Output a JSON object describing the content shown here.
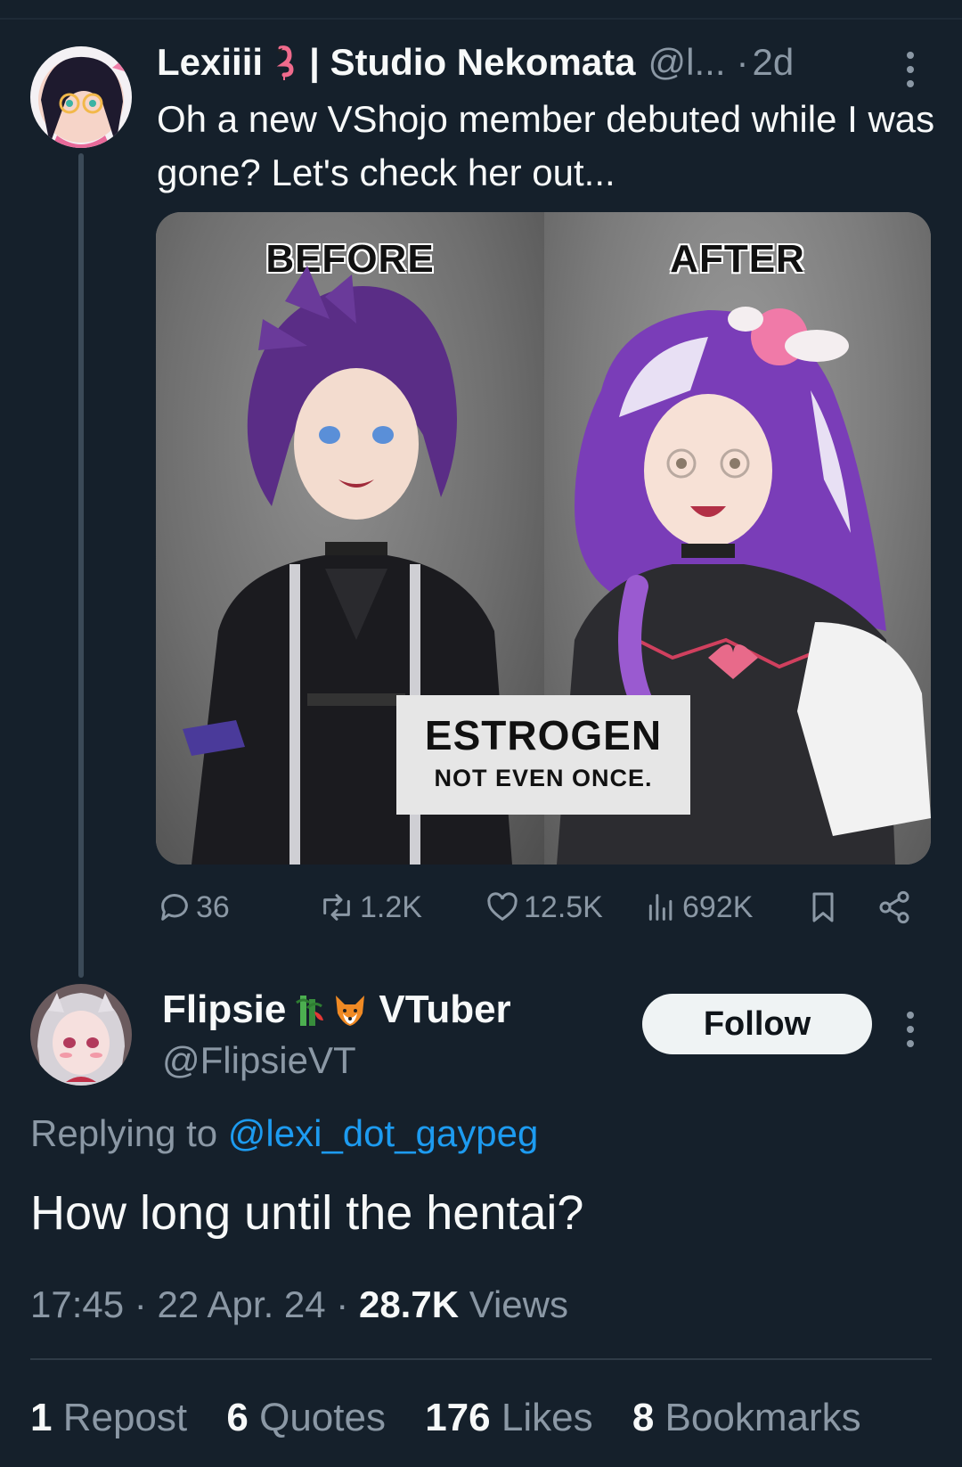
{
  "tweet": {
    "author_name": "Lexiiii",
    "author_suffix": "| Studio Nekomata",
    "author_handle_truncated": "@l...",
    "separator": "·",
    "time_ago": "2d",
    "text": "Oh a new VShojo member debuted while I was gone? Let's check her out...",
    "media": {
      "left_label": "BEFORE",
      "right_label": "AFTER",
      "caption_main": "ESTROGEN",
      "caption_sub": "NOT EVEN ONCE."
    },
    "actions": {
      "replies": "36",
      "reposts": "1.2K",
      "likes": "12.5K",
      "views": "692K"
    }
  },
  "reply": {
    "author_name": "Flipsie",
    "author_suffix": "VTuber",
    "author_handle": "@FlipsieVT",
    "follow_label": "Follow",
    "replying_prefix": "Replying to",
    "replying_to": "@lexi_dot_gaypeg",
    "text": "How long until the hentai?",
    "time": "17:45",
    "date": "22 Apr. 24",
    "separator": "·",
    "views_count": "28.7K",
    "views_label": "Views",
    "stats": [
      {
        "count": "1",
        "label": "Repost"
      },
      {
        "count": "6",
        "label": "Quotes"
      },
      {
        "count": "176",
        "label": "Likes"
      },
      {
        "count": "8",
        "label": "Bookmarks"
      }
    ]
  },
  "icons": [
    "flamingo-emoji-icon",
    "more-icon",
    "reply-icon",
    "repost-icon",
    "like-icon",
    "views-icon",
    "bookmark-icon",
    "share-icon",
    "bamboo-emoji-icon",
    "fox-emoji-icon"
  ],
  "colors": {
    "background": "#15202b",
    "accent": "#1d9bf0",
    "muted": "#8b98a5",
    "text": "#f7f9f9"
  }
}
